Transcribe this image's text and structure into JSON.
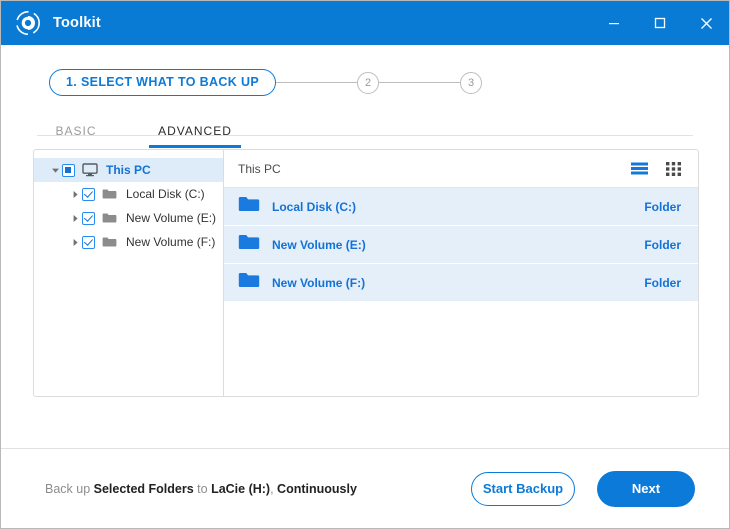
{
  "window": {
    "title": "Toolkit",
    "logo_icon": "toolkit-logo-icon",
    "controls": [
      {
        "name": "minimize",
        "icon": "minimize-icon"
      },
      {
        "name": "maximize",
        "icon": "maximize-icon"
      },
      {
        "name": "close",
        "icon": "close-icon"
      }
    ]
  },
  "stepper": {
    "step1_label": "1. SELECT WHAT TO BACK UP",
    "step2_label": "2",
    "step3_label": "3"
  },
  "tabs": [
    {
      "label": "BASIC",
      "active": false
    },
    {
      "label": "ADVANCED",
      "active": true
    }
  ],
  "tree": {
    "root": {
      "label": "This PC",
      "icon": "monitor-icon",
      "checkbox_state": "indeterminate",
      "twisty": "chevron-down-icon"
    },
    "children": [
      {
        "label": "Local Disk (C:)",
        "icon": "folder-icon",
        "checkbox_state": "checked",
        "twisty": "chevron-right-icon"
      },
      {
        "label": "New Volume (E:)",
        "icon": "folder-icon",
        "checkbox_state": "checked",
        "twisty": "chevron-right-icon"
      },
      {
        "label": "New Volume (F:)",
        "icon": "folder-icon",
        "checkbox_state": "checked",
        "twisty": "chevron-right-icon"
      }
    ]
  },
  "content": {
    "breadcrumb": "This PC",
    "view_list_icon": "list-view-icon",
    "view_grid_icon": "grid-view-icon",
    "rows": [
      {
        "name": "Local Disk (C:)",
        "type": "Folder",
        "icon": "folder-icon"
      },
      {
        "name": "New Volume (E:)",
        "type": "Folder",
        "icon": "folder-icon"
      },
      {
        "name": "New Volume (F:)",
        "type": "Folder",
        "icon": "folder-icon"
      }
    ]
  },
  "footer": {
    "summary": {
      "prefix": "Back up ",
      "what": "Selected Folders",
      "middle": " to ",
      "target": "LaCie (H:)",
      "separator": ", ",
      "schedule": "Continuously"
    },
    "start_backup_label": "Start Backup",
    "next_label": "Next"
  },
  "colors": {
    "title_bar_blue": "#0a7bd4",
    "accent_blue": "#0c7ad8",
    "link_blue": "#1472d6",
    "row_selected": "#e4eff9",
    "tree_selected": "#deecf9",
    "muted_gray": "#9a9a9a"
  }
}
